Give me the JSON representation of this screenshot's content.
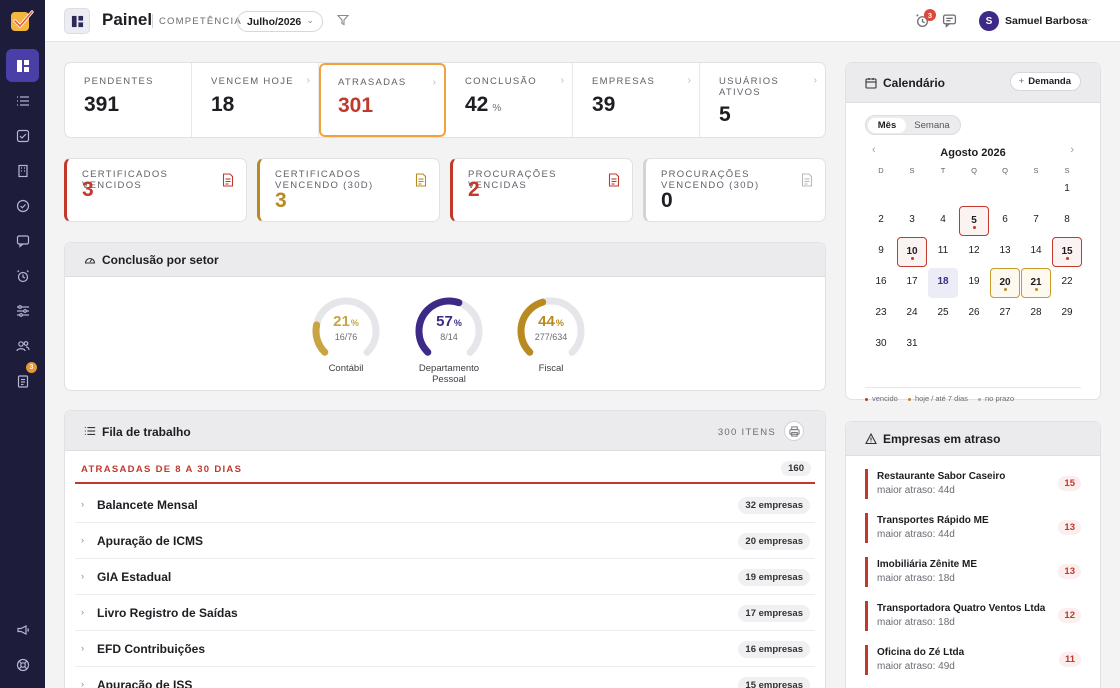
{
  "colors": {
    "sidebar": "#1d1c3b",
    "accent": "#4a3fa6",
    "danger": "#c0392b",
    "warning": "#b98a1f",
    "highlight_border": "#f2a23a"
  },
  "sidebar": {
    "items": [
      {
        "icon": "dashboard-icon",
        "active": true
      },
      {
        "icon": "list-icon"
      },
      {
        "icon": "checklist-icon"
      },
      {
        "icon": "building-icon"
      },
      {
        "icon": "check-circle-icon"
      },
      {
        "icon": "message-icon"
      },
      {
        "icon": "alarm-icon"
      },
      {
        "icon": "sliders-icon"
      },
      {
        "icon": "users-icon"
      },
      {
        "icon": "clipboard-icon",
        "badge": "3"
      }
    ],
    "bottom": [
      {
        "icon": "megaphone-icon"
      },
      {
        "icon": "help-icon"
      }
    ]
  },
  "header": {
    "title": "Painel",
    "competencia_label": "COMPETÊNCIA",
    "competencia_value": "Julho/2026",
    "notifications_badge": "3",
    "user_initial": "S",
    "user_name": "Samuel Barbosa"
  },
  "stats": [
    {
      "label": "PENDENTES",
      "value": "391"
    },
    {
      "label": "VENCEM HOJE",
      "value": "18"
    },
    {
      "label": "ATRASADAS",
      "value": "301"
    },
    {
      "label": "CONCLUSÃO",
      "value": "42",
      "unit": "%"
    },
    {
      "label": "EMPRESAS",
      "value": "39"
    },
    {
      "label": "USUÁRIOS ATIVOS",
      "value": "5"
    }
  ],
  "doc_cards": [
    {
      "label": "CERTIFICADOS VENCIDOS",
      "value": "3"
    },
    {
      "label": "CERTIFICADOS VENCENDO (30D)",
      "value": "3"
    },
    {
      "label": "PROCURAÇÕES VENCIDAS",
      "value": "2"
    },
    {
      "label": "PROCURAÇÕES VENCENDO (30D)",
      "value": "0"
    }
  ],
  "conclusao": {
    "title": "Conclusão por setor",
    "sectors": [
      {
        "name": "Contábil",
        "pct": "21",
        "pct_unit": "%",
        "fraction": "16/76",
        "value": 0.21,
        "color": "#c9a443"
      },
      {
        "name": "Departamento Pessoal",
        "pct": "57",
        "pct_unit": "%",
        "fraction": "8/14",
        "value": 0.57,
        "color": "#3d2a86"
      },
      {
        "name": "Fiscal",
        "pct": "44",
        "pct_unit": "%",
        "fraction": "277/634",
        "value": 0.44,
        "color": "#b98a1f"
      }
    ]
  },
  "queue": {
    "title": "Fila de trabalho",
    "items_count": "300 ITENS",
    "group_label": "ATRASADAS DE 8 A 30 DIAS",
    "group_count": "160",
    "rows": [
      {
        "name": "Balancete Mensal",
        "count": "32 empresas"
      },
      {
        "name": "Apuração de ICMS",
        "count": "20 empresas"
      },
      {
        "name": "GIA Estadual",
        "count": "19 empresas"
      },
      {
        "name": "Livro Registro de Saídas",
        "count": "17 empresas"
      },
      {
        "name": "EFD Contribuições",
        "count": "16 empresas"
      },
      {
        "name": "Apuração de ISS",
        "count": "15 empresas"
      }
    ]
  },
  "calendar": {
    "title": "Calendário",
    "new_button": "Demanda",
    "tabs": [
      "Mês",
      "Semana"
    ],
    "month": "Agosto 2026",
    "weekdays": [
      "D",
      "S",
      "T",
      "Q",
      "Q",
      "S",
      "S"
    ],
    "first_weekday": 6,
    "days_in_month": 31,
    "today": 18,
    "marked": {
      "5": "red",
      "10": "red",
      "15": "red",
      "20": "amber",
      "21": "amber"
    },
    "legend": [
      "vencido",
      "hoje / até 7 dias",
      "no prazo"
    ]
  },
  "empresas_atraso": {
    "title": "Empresas em atraso",
    "items": [
      {
        "name": "Restaurante Sabor Caseiro",
        "sub": "maior atraso: 44d",
        "count": "15"
      },
      {
        "name": "Transportes Rápido ME",
        "sub": "maior atraso: 44d",
        "count": "13"
      },
      {
        "name": "Imobiliária Zênite ME",
        "sub": "maior atraso: 18d",
        "count": "13"
      },
      {
        "name": "Transportadora Quatro Ventos Ltda",
        "sub": "maior atraso: 18d",
        "count": "12"
      },
      {
        "name": "Oficina do Zé Ltda",
        "sub": "maior atraso: 49d",
        "count": "11"
      }
    ]
  }
}
